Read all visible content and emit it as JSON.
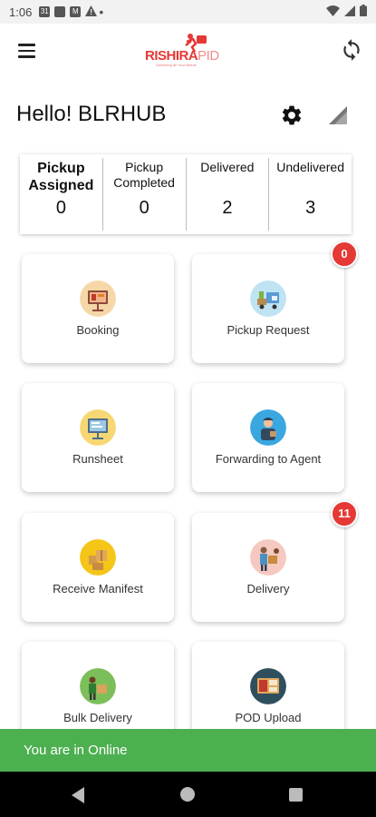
{
  "status_bar": {
    "time": "1:06",
    "icons": [
      "calendar-icon",
      "photo-icon",
      "gmail-icon",
      "warning-icon",
      "wifi-icon",
      "cell-signal-icon",
      "battery-icon"
    ],
    "dot": "•"
  },
  "app_bar": {
    "logo_main": "RISHIRA",
    "logo_accent": "PID",
    "logo_tagline": "Delivering all Your Needs",
    "menu_icon": "menu-icon",
    "refresh_icon": "refresh-icon"
  },
  "greeting": {
    "text": "Hello! BLRHUB",
    "settings_icon": "gear-icon",
    "signal_icon": "signal-icon"
  },
  "stats": [
    {
      "label": "Pickup\nAssigned",
      "value": "0"
    },
    {
      "label": "Pickup\nCompleted",
      "value": "0"
    },
    {
      "label": "Delivered",
      "value": "2"
    },
    {
      "label": "Undelivered",
      "value": "3"
    }
  ],
  "tiles": [
    {
      "label": "Booking",
      "icon": "booking-icon"
    },
    {
      "label": "Pickup Request",
      "icon": "pickup-request-icon",
      "badge": "0"
    },
    {
      "label": "Runsheet",
      "icon": "runsheet-icon"
    },
    {
      "label": "Forwarding to Agent",
      "icon": "forwarding-agent-icon"
    },
    {
      "label": "Receive Manifest",
      "icon": "receive-manifest-icon"
    },
    {
      "label": "Delivery",
      "icon": "delivery-icon",
      "badge": "11"
    },
    {
      "label": "Bulk Delivery",
      "icon": "bulk-delivery-icon"
    },
    {
      "label": "POD Upload",
      "icon": "pod-upload-icon"
    }
  ],
  "snackbar": {
    "text": "You are in Online"
  },
  "colors": {
    "brand": "#e53935",
    "badge": "#e53935",
    "snackbar": "#4caf50"
  }
}
